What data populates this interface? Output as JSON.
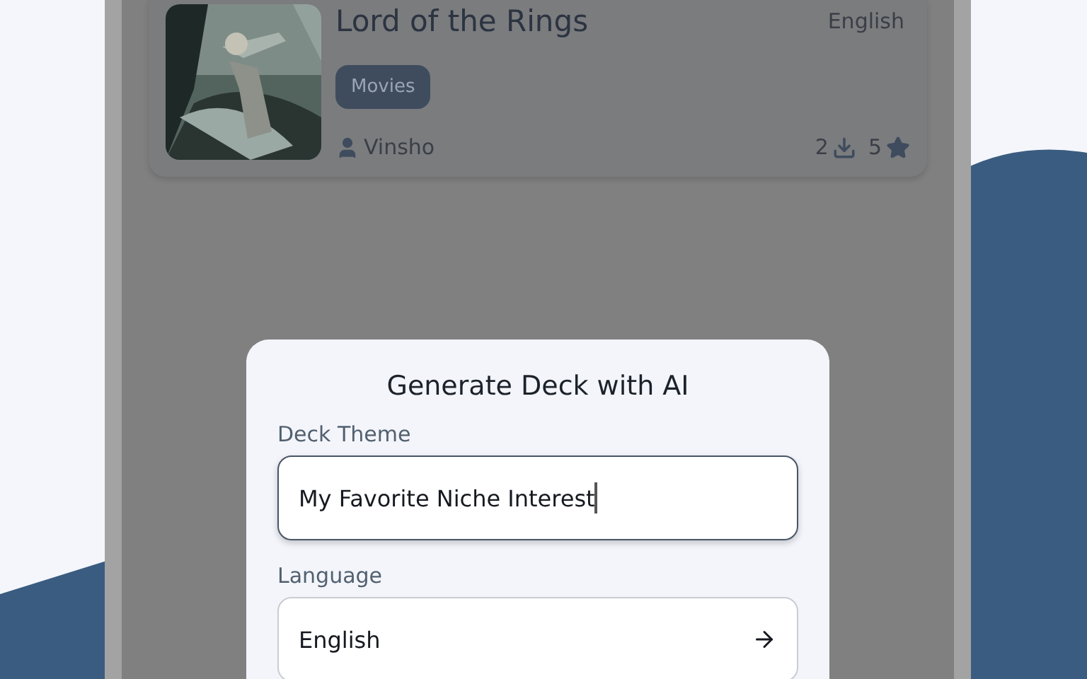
{
  "deck_card": {
    "title": "Lord of the Rings",
    "language": "English",
    "tag": "Movies",
    "author": "Vinsho",
    "downloads": "2",
    "rating": "5"
  },
  "dialog": {
    "title": "Generate Deck with AI",
    "fields": [
      {
        "kind": "text",
        "label": "Deck Theme",
        "value": "My Favorite Niche Interest",
        "focused": true
      },
      {
        "kind": "select",
        "label": "Language",
        "value": "English",
        "focused": false
      }
    ]
  }
}
